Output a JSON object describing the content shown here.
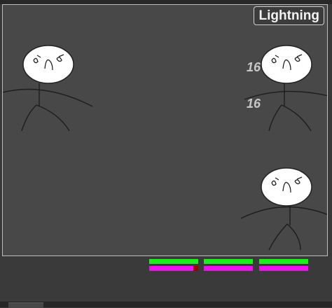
{
  "spell_label": "Lightning",
  "damage_numbers": [
    "16",
    "16"
  ],
  "colors": {
    "health": "#19f019",
    "mana": "#ee10ee",
    "damage_taken": "#a00000"
  },
  "enemies": [
    {
      "name": "enemy-left",
      "health": 1.0,
      "mana": 0.9
    },
    {
      "name": "enemy-middle",
      "health": 1.0,
      "mana": 1.0
    },
    {
      "name": "enemy-right",
      "health": 1.0,
      "mana": 1.0
    }
  ]
}
